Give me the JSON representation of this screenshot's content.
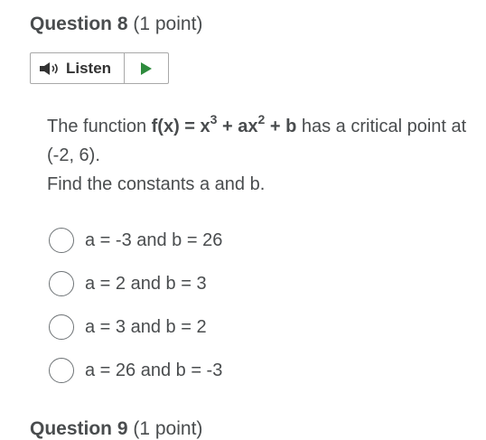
{
  "question": {
    "title": "Question 8",
    "points": "(1 point)"
  },
  "listen": {
    "label": "Listen",
    "speaker_icon": "speaker-icon",
    "play_icon": "play-icon",
    "play_color": "#2e8b3d"
  },
  "prompt": {
    "pre": "The function ",
    "fx": "f(x) = x",
    "exp1": "3",
    "plus_ax": " + ax",
    "exp2": "2",
    "plus_b": " + b",
    "post": " has a critical point at (-2, 6).",
    "line2": "Find the constants a and b."
  },
  "options": [
    {
      "label": "a = -3 and b = 26"
    },
    {
      "label": "a = 2 and b = 3"
    },
    {
      "label": "a = 3 and b = 2"
    },
    {
      "label": "a = 26 and b = -3"
    }
  ],
  "next_question": {
    "title": "Question 9",
    "points": "(1 point)"
  }
}
